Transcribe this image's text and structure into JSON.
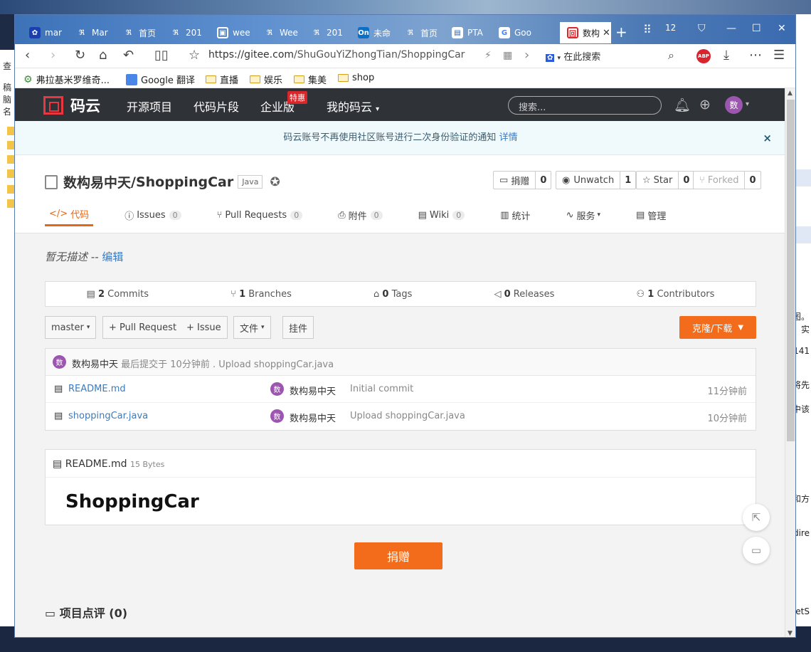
{
  "background": {
    "left_labels": [
      "查",
      "稿脑",
      "名"
    ],
    "right_texts": [
      "图。",
      "；实",
      "141",
      "将先",
      "中该",
      "和方",
      "dire",
      "etS"
    ]
  },
  "tabs": [
    {
      "label": "mar",
      "icon": "paw-icon"
    },
    {
      "label": "Mar",
      "icon": "gitee-icon"
    },
    {
      "label": "首页",
      "icon": "gitee-icon"
    },
    {
      "label": "201",
      "icon": "gitee-icon"
    },
    {
      "label": "wee",
      "icon": "qr-icon"
    },
    {
      "label": "Wee",
      "icon": "gitee-icon"
    },
    {
      "label": "201",
      "icon": "gitee-icon"
    },
    {
      "label": "未命",
      "icon": "onenote-icon"
    },
    {
      "label": "首页",
      "icon": "gitee-icon"
    },
    {
      "label": "PTA",
      "icon": "pta-icon"
    },
    {
      "label": "Goo",
      "icon": "google-icon"
    },
    {
      "label": "数构",
      "icon": "mayun-icon"
    }
  ],
  "tab_count_badge": "12",
  "address": {
    "url_host": "https://gitee.com",
    "url_path": "/ShuGouYiZhongTian/ShoppingCar",
    "search_placeholder": "在此搜索",
    "abp": "ABP"
  },
  "bookmarks": [
    "弗拉基米罗维奇...",
    "Google 翻译",
    "直播",
    "娱乐",
    "集美",
    "shop"
  ],
  "nav": {
    "logo": "码云",
    "links": [
      "开源项目",
      "代码片段",
      "企业版",
      "我的码云"
    ],
    "hot_badge": "特惠",
    "search_placeholder": "搜索...",
    "avatar": "数"
  },
  "notice": {
    "text": "码云账号不再使用社区账号进行二次身份验证的通知",
    "link": "详情",
    "close": "×"
  },
  "repo": {
    "owner": "数构易中天",
    "separator": " / ",
    "name": "ShoppingCar",
    "lang": "Java",
    "donate_label": "捐赠",
    "donate_count": "0",
    "watch_label": "Unwatch",
    "watch_count": "1",
    "star_label": "Star",
    "star_count": "0",
    "fork_label": "Forked",
    "fork_count": "0"
  },
  "repo_tabs": [
    {
      "label": "代码",
      "count": ""
    },
    {
      "label": "Issues",
      "count": "0"
    },
    {
      "label": "Pull Requests",
      "count": "0"
    },
    {
      "label": "附件",
      "count": "0"
    },
    {
      "label": "Wiki",
      "count": "0"
    },
    {
      "label": "统计",
      "count": ""
    },
    {
      "label": "服务",
      "count": ""
    },
    {
      "label": "管理",
      "count": ""
    }
  ],
  "description": {
    "text": "暂无描述",
    "sep": " -- ",
    "edit": "编辑"
  },
  "stats": [
    {
      "num": "2",
      "label": "Commits"
    },
    {
      "num": "1",
      "label": "Branches"
    },
    {
      "num": "0",
      "label": "Tags"
    },
    {
      "num": "0",
      "label": "Releases"
    },
    {
      "num": "1",
      "label": "Contributors"
    }
  ],
  "controls": {
    "branch": "master",
    "pull_request": "+ Pull Request",
    "issue": "+ Issue",
    "file": "文件",
    "widget": "挂件",
    "clone": "克隆/下载"
  },
  "last_commit": {
    "author": "数构易中天",
    "text": "最后提交于 10分钟前 .",
    "message": "Upload shoppingCar.java"
  },
  "files": [
    {
      "name": "README.md",
      "author": "数构易中天",
      "message": "Initial commit",
      "time": "11分钟前"
    },
    {
      "name": "shoppingCar.java",
      "author": "数构易中天",
      "message": "Upload shoppingCar.java",
      "time": "10分钟前"
    }
  ],
  "readme": {
    "filename": "README.md",
    "size": "15 Bytes",
    "heading": "ShoppingCar"
  },
  "donate_button": "捐赠",
  "review": {
    "title": "项目点评 (0)"
  },
  "avatar_char": "数"
}
